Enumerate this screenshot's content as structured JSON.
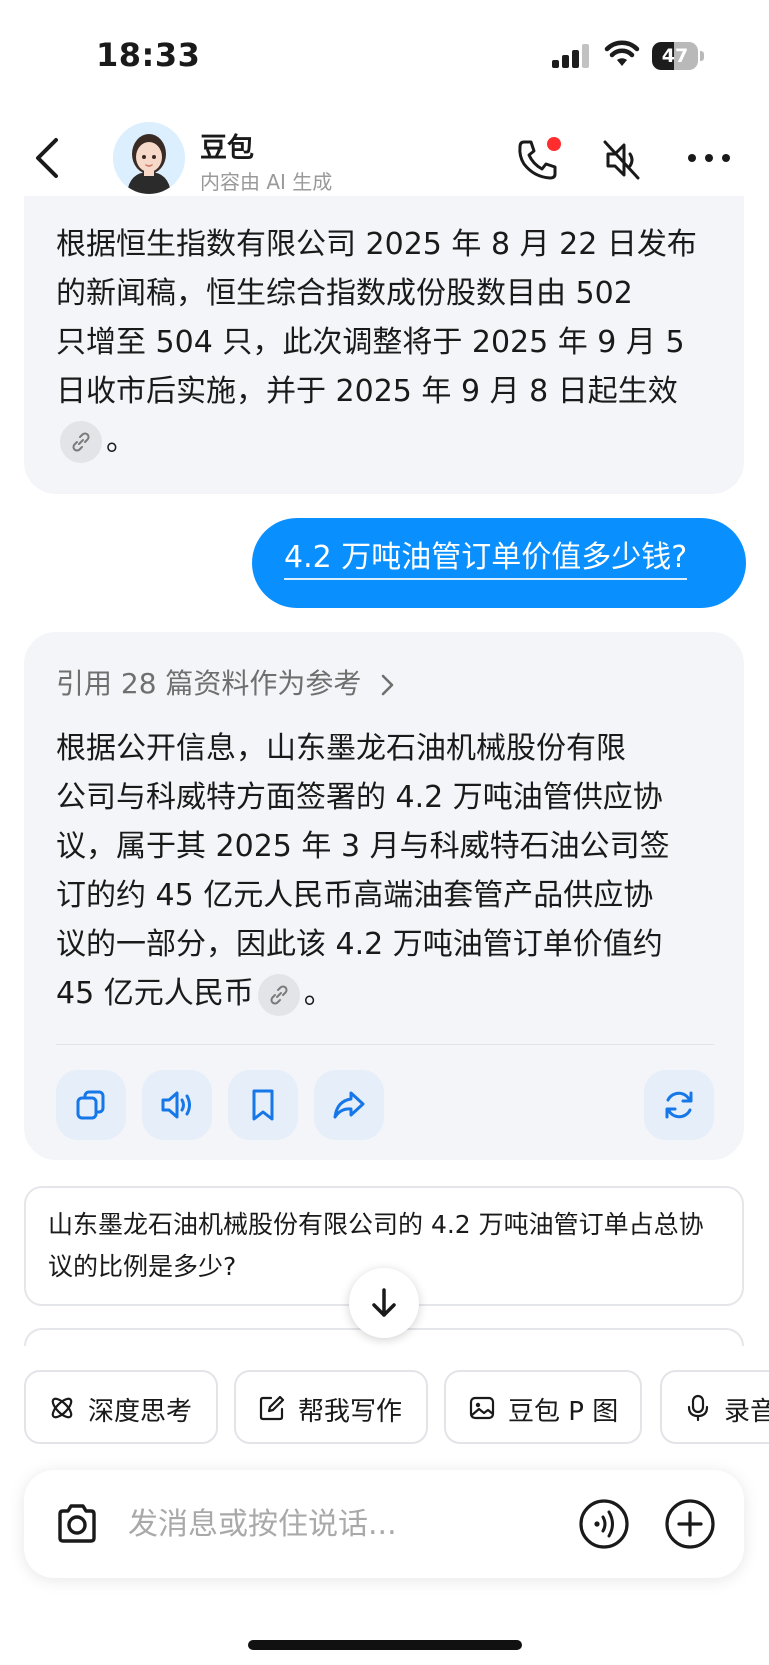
{
  "status_bar": {
    "time": "18:33",
    "battery": "47",
    "battery_level": 0.47
  },
  "header": {
    "title": "豆包",
    "subtitle": "内容由 AI 生成"
  },
  "messages": [
    {
      "role": "assistant",
      "lines": [
        "根据恒生指数有限公司 2025 年 8 月 22 日发布",
        "的新闻稿，恒生综合指数成份股数目由 502",
        "只增至 504 只，此次调整将于 2025 年 9 月 5",
        "日收市后实施，并于 2025 年 9 月 8 日起生效"
      ],
      "tail": "。"
    },
    {
      "role": "user",
      "text": "4.2 万吨油管订单价值多少钱?"
    },
    {
      "role": "assistant",
      "reference": "引用 28 篇资料作为参考",
      "lines": [
        "根据公开信息，山东墨龙石油机械股份有限",
        "公司与科威特方面签署的 4.2 万吨油管供应协",
        "议，属于其 2025 年 3 月与科威特石油公司签",
        "订的约 45 亿元人民币高端油套管产品供应协",
        "议的一部分，因此该 4.2 万吨油管订单价值约",
        " 45 亿元人民币"
      ],
      "tail": "。"
    }
  ],
  "actions": [
    "copy-icon",
    "speaker-icon",
    "bookmark-icon",
    "share-icon",
    "regenerate-icon"
  ],
  "suggestion": "山东墨龙石油机械股份有限公司的 4.2 万吨油管订单占总协议的比例是多少?",
  "tools": [
    {
      "label": "深度思考",
      "icon": "atom-icon"
    },
    {
      "label": "帮我写作",
      "icon": "edit-icon"
    },
    {
      "label": "豆包 P 图",
      "icon": "image-edit-icon"
    },
    {
      "label": "录音",
      "icon": "mic-icon"
    }
  ],
  "input": {
    "placeholder": "发消息或按住说话..."
  },
  "colors": {
    "user_bubble": "#0a8fff",
    "ai_bubble": "#f3f5f8",
    "notification_dot": "#ff2d2d"
  }
}
